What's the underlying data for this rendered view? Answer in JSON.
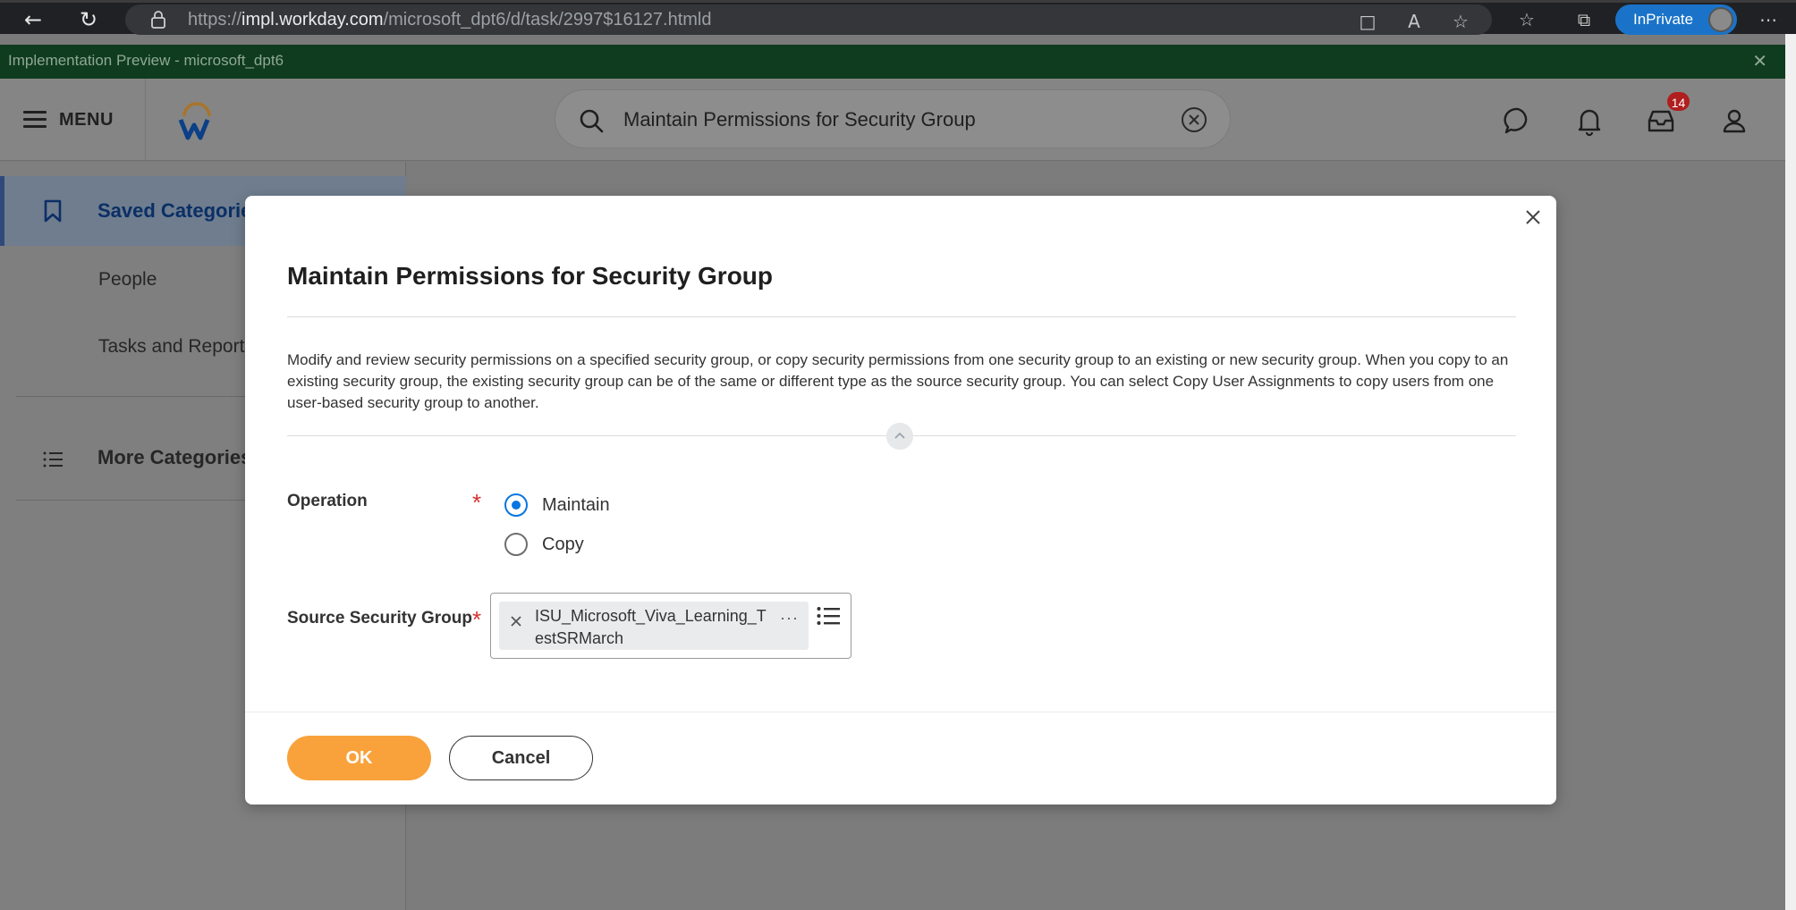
{
  "browser": {
    "url_prefix": "https://",
    "url_host": "impl.workday.com",
    "url_path": "/microsoft_dpt6/d/task/2997$16127.htmld",
    "inprivate_label": "InPrivate"
  },
  "banner": {
    "text": "Implementation Preview - microsoft_dpt6"
  },
  "header": {
    "menu_label": "MENU",
    "search_value": "Maintain Permissions for Security Group",
    "inbox_badge": "14"
  },
  "sidebar": {
    "active_item": "Saved Categories",
    "items": [
      "People",
      "Tasks and Reports"
    ],
    "more_label": "More Categories"
  },
  "modal": {
    "title": "Maintain Permissions for Security Group",
    "description": "Modify and review security permissions on a specified security group, or copy security permissions from one security group to an existing or new security group. When you copy to an existing security group, the existing security group can be of the same or different type as the source security group. You can select Copy User Assignments to copy users from one user-based security group to another.",
    "operation": {
      "label": "Operation",
      "required_mark": "*",
      "options": [
        "Maintain",
        "Copy"
      ],
      "selected": "Maintain"
    },
    "source_group": {
      "label": "Source Security Group",
      "required_mark": "*",
      "selected_value": "ISU_Microsoft_Viva_Learning_TestSRMarch",
      "more": "···"
    },
    "ok_label": "OK",
    "cancel_label": "Cancel"
  },
  "colors": {
    "accent_orange": "#f9a23b",
    "radio_blue": "#0875e1",
    "required_red": "#d0332f",
    "badge_red": "#b01e1e"
  }
}
